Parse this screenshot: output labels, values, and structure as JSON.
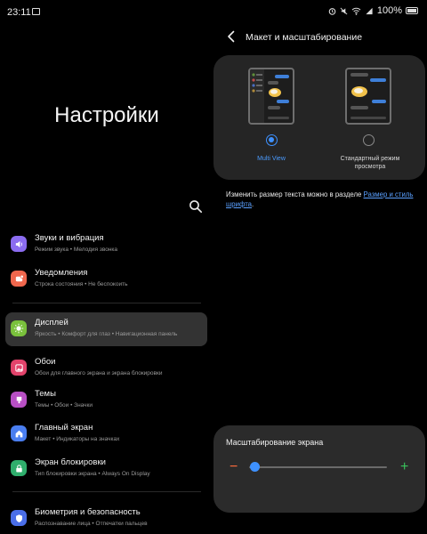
{
  "status": {
    "time": "23:11",
    "battery": "100%"
  },
  "settings": {
    "title": "Настройки",
    "items": [
      {
        "label": "Звуки и вибрация",
        "sub": "Режим звука  •  Мелодия звонка",
        "icon": "speaker-icon",
        "color": "#8b6cf0"
      },
      {
        "label": "Уведомления",
        "sub": "Строка состояния  •  Не беспокоить",
        "icon": "notification-icon",
        "color": "#f0674d"
      },
      {
        "label": "Дисплей",
        "sub": "Яркость  •  Комфорт для глаз  •  Навигационная панель",
        "icon": "sun-icon",
        "color": "#7ac13c"
      },
      {
        "label": "Обои",
        "sub": "Обои для главного экрана и экрана блокировки",
        "icon": "wallpaper-icon",
        "color": "#e2436b"
      },
      {
        "label": "Темы",
        "sub": "Темы  •  Обои  •  Значки",
        "icon": "themes-icon",
        "color": "#b84fc4"
      },
      {
        "label": "Главный экран",
        "sub": "Макет  •  Индикаторы на значках",
        "icon": "home-icon",
        "color": "#4a7ef0"
      },
      {
        "label": "Экран блокировки",
        "sub": "Тип блокировки экрана  •  Always On Display",
        "icon": "lock-icon",
        "color": "#2fae6c"
      },
      {
        "label": "Биометрия и безопасность",
        "sub": "Распознавание лица  •  Отпечатки пальцев",
        "icon": "shield-icon",
        "color": "#4a6ee8"
      }
    ]
  },
  "layout_page": {
    "title": "Макет и масштабирование",
    "option_multi": "Multi View",
    "option_standard_line1": "Стандартный режим",
    "option_standard_line2": "просмотра",
    "selected": "Multi View",
    "hint_text": "Изменить размер текста можно в разделе ",
    "hint_link": "Размер и стиль шрифта",
    "hint_end": ".",
    "zoom_title": "Масштабирование экрана",
    "zoom_level": 0.02
  },
  "colors": {
    "accent": "#3e91ff",
    "minus": "#ff6b3d",
    "plus": "#39c15b"
  }
}
